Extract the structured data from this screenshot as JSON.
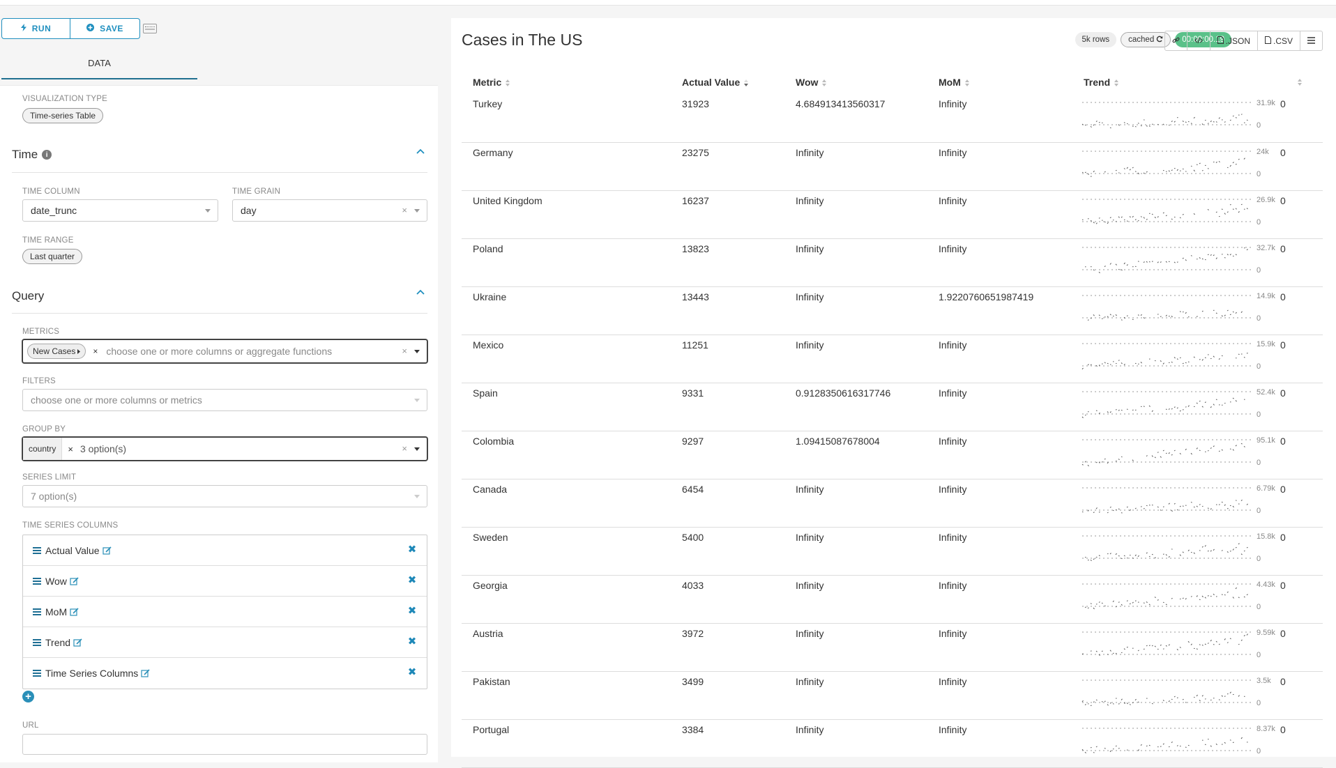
{
  "toolbar": {
    "run_label": "RUN",
    "save_label": "SAVE"
  },
  "tabs": {
    "data_label": "DATA"
  },
  "viz": {
    "label": "VISUALIZATION TYPE",
    "value": "Time-series Table"
  },
  "time": {
    "title": "Time",
    "time_column_label": "TIME COLUMN",
    "time_column_value": "date_trunc",
    "time_grain_label": "TIME GRAIN",
    "time_grain_value": "day",
    "time_range_label": "TIME RANGE",
    "time_range_value": "Last quarter"
  },
  "query": {
    "title": "Query",
    "metrics_label": "METRICS",
    "metric_chip": "New Cases",
    "metrics_placeholder": "choose one or more columns or aggregate functions",
    "filters_label": "FILTERS",
    "filters_placeholder": "choose one or more columns or metrics",
    "groupby_label": "GROUP BY",
    "groupby_chip": "country",
    "groupby_options": "3 option(s)",
    "series_limit_label": "SERIES LIMIT",
    "series_limit_value": "7 option(s)",
    "ts_columns_label": "TIME SERIES COLUMNS",
    "ts_columns": [
      "Actual Value",
      "Wow",
      "MoM",
      "Trend",
      "Time Series Columns"
    ],
    "url_label": "URL"
  },
  "chart": {
    "title": "Cases in The US",
    "rows_badge": "5k rows",
    "cached_badge": "cached",
    "timer_badge": "00:00:00.19",
    "json_label": ".JSON",
    "csv_label": ".CSV",
    "columns": [
      "Metric",
      "Actual Value",
      "Wow",
      "MoM",
      "Trend"
    ],
    "rows": [
      {
        "metric": "Turkey",
        "actual": "31923",
        "wow": "4.684913413560317",
        "mom": "Infinity",
        "max": "31.9k",
        "min": "0",
        "zero": "0"
      },
      {
        "metric": "Germany",
        "actual": "23275",
        "wow": "Infinity",
        "mom": "Infinity",
        "max": "24k",
        "min": "0",
        "zero": "0"
      },
      {
        "metric": "United Kingdom",
        "actual": "16237",
        "wow": "Infinity",
        "mom": "Infinity",
        "max": "26.9k",
        "min": "0",
        "zero": "0"
      },
      {
        "metric": "Poland",
        "actual": "13823",
        "wow": "Infinity",
        "mom": "Infinity",
        "max": "32.7k",
        "min": "0",
        "zero": "0"
      },
      {
        "metric": "Ukraine",
        "actual": "13443",
        "wow": "Infinity",
        "mom": "1.9220760651987419",
        "max": "14.9k",
        "min": "0",
        "zero": "0"
      },
      {
        "metric": "Mexico",
        "actual": "11251",
        "wow": "Infinity",
        "mom": "Infinity",
        "max": "15.9k",
        "min": "0",
        "zero": "0"
      },
      {
        "metric": "Spain",
        "actual": "9331",
        "wow": "0.9128350616317746",
        "mom": "Infinity",
        "max": "52.4k",
        "min": "0",
        "zero": "0"
      },
      {
        "metric": "Colombia",
        "actual": "9297",
        "wow": "1.09415087678004",
        "mom": "Infinity",
        "max": "95.1k",
        "min": "0",
        "zero": "0"
      },
      {
        "metric": "Canada",
        "actual": "6454",
        "wow": "Infinity",
        "mom": "Infinity",
        "max": "6.79k",
        "min": "0",
        "zero": "0"
      },
      {
        "metric": "Sweden",
        "actual": "5400",
        "wow": "Infinity",
        "mom": "Infinity",
        "max": "15.8k",
        "min": "0",
        "zero": "0"
      },
      {
        "metric": "Georgia",
        "actual": "4033",
        "wow": "Infinity",
        "mom": "Infinity",
        "max": "4.43k",
        "min": "0",
        "zero": "0"
      },
      {
        "metric": "Austria",
        "actual": "3972",
        "wow": "Infinity",
        "mom": "Infinity",
        "max": "9.59k",
        "min": "0",
        "zero": "0"
      },
      {
        "metric": "Pakistan",
        "actual": "3499",
        "wow": "Infinity",
        "mom": "Infinity",
        "max": "3.5k",
        "min": "0",
        "zero": "0"
      },
      {
        "metric": "Portugal",
        "actual": "3384",
        "wow": "Infinity",
        "mom": "Infinity",
        "max": "8.37k",
        "min": "0",
        "zero": "0"
      }
    ]
  },
  "colors": {
    "accent": "#1f8fbf",
    "timer_green": "#5ac189"
  }
}
